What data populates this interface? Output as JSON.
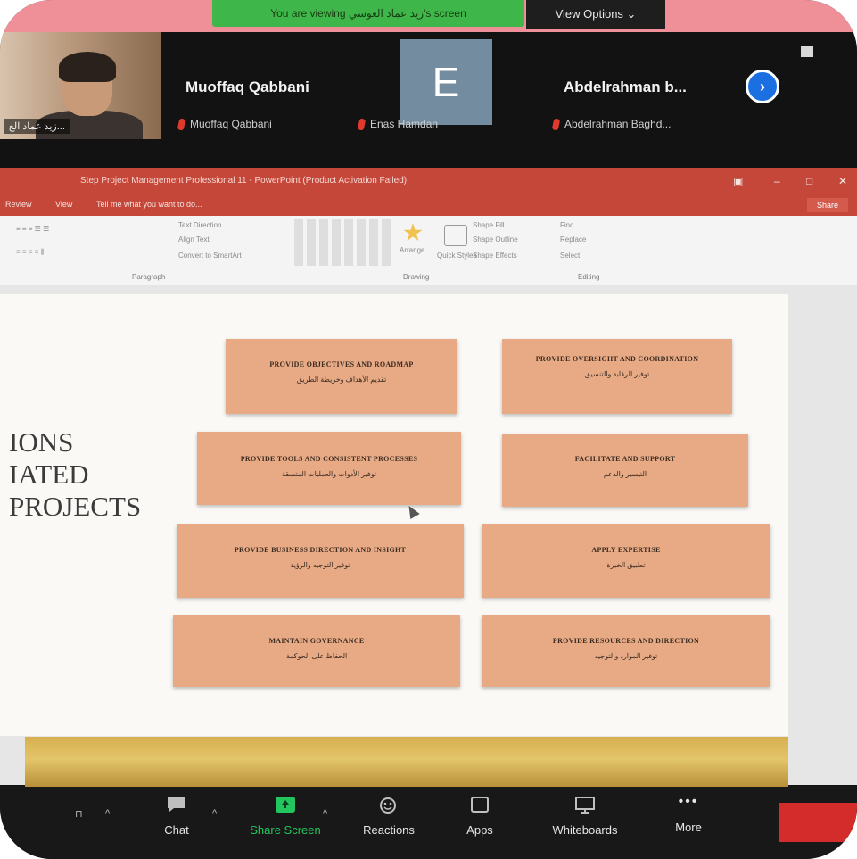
{
  "banner": {
    "notice": "You are viewing زيد عماد العوسي's screen",
    "view_options": "View Options ⌄"
  },
  "participants": [
    {
      "name": "زيد عماد الع..."
    },
    {
      "name": "Muoffaq Qabbani",
      "label": "Muoffaq Qabbani"
    },
    {
      "initial": "E",
      "label": "Enas Hamdan"
    },
    {
      "name": "Abdelrahman b...",
      "label": "Abdelrahman Baghd..."
    }
  ],
  "powerpoint": {
    "title": "Step Project Management Professional 11 - PowerPoint (Product Activation Failed)",
    "menu": [
      "Review",
      "View",
      "Tell me what you want to do..."
    ],
    "share": "Share",
    "ribbon_groups": {
      "paragraph": "Paragraph",
      "drawing": "Drawing",
      "editing": "Editing"
    },
    "ribbon_text": {
      "text_direction": "Text Direction",
      "align_text": "Align Text",
      "convert_smartart": "Convert to SmartArt",
      "arrange": "Arrange",
      "quick_styles": "Quick Styles",
      "shape_fill": "Shape Fill",
      "shape_outline": "Shape Outline",
      "shape_effects": "Shape Effects",
      "find": "Find",
      "replace": "Replace",
      "select": "Select"
    }
  },
  "slide": {
    "heading_lines": [
      "IONS",
      "IATED",
      "PROJECTS"
    ],
    "cards": [
      {
        "en": "PROVIDE OBJECTIVES AND ROADMAP",
        "ar": "تقديم الأهداف وخريطة الطريق"
      },
      {
        "en": "PROVIDE OVERSIGHT AND COORDINATION",
        "ar": "توفير الرقابة والتنسيق"
      },
      {
        "en": "PROVIDE TOOLS AND CONSISTENT PROCESSES",
        "ar": "توفير الأدوات والعمليات المتسقة"
      },
      {
        "en": "FACILITATE AND SUPPORT",
        "ar": "التيسير والدعم"
      },
      {
        "en": "PROVIDE BUSINESS DIRECTION AND INSIGHT",
        "ar": "توفير التوجيه والرؤية"
      },
      {
        "en": "APPLY EXPERTISE",
        "ar": "تطبيق الخبرة"
      },
      {
        "en": "MAINTAIN GOVERNANCE",
        "ar": "الحفاظ على الحوكمة"
      },
      {
        "en": "PROVIDE RESOURCES AND DIRECTION",
        "ar": "توفير الموارد والتوجيه"
      }
    ]
  },
  "toolbar": {
    "chat": "Chat",
    "share_screen": "Share Screen",
    "reactions": "Reactions",
    "apps": "Apps",
    "whiteboards": "Whiteboards",
    "more": "More"
  },
  "colors": {
    "card": "#e7aa85",
    "ppt": "#c4473a",
    "banner_green": "#3fb64a",
    "share_green": "#22c55e"
  }
}
